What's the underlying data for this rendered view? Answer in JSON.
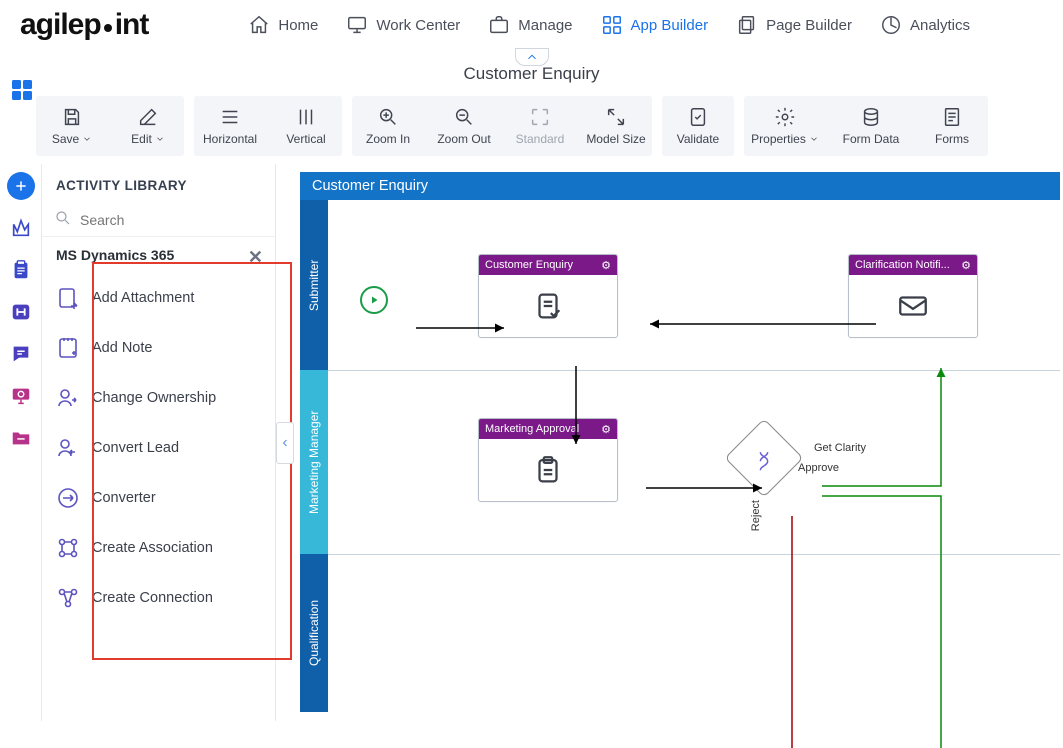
{
  "logo_text_1": "agilep",
  "logo_text_2": "int",
  "nav": {
    "home": "Home",
    "work_center": "Work Center",
    "manage": "Manage",
    "app_builder": "App Builder",
    "page_builder": "Page Builder",
    "analytics": "Analytics"
  },
  "page_title": "Customer Enquiry",
  "toolbar": {
    "save": "Save",
    "edit": "Edit",
    "horizontal": "Horizontal",
    "vertical": "Vertical",
    "zoom_in": "Zoom In",
    "zoom_out": "Zoom Out",
    "standard": "Standard",
    "model_size": "Model Size",
    "validate": "Validate",
    "properties": "Properties",
    "form_data": "Form Data",
    "forms": "Forms"
  },
  "panel": {
    "header": "ACTIVITY LIBRARY",
    "search_placeholder": "Search",
    "category": "MS Dynamics 365",
    "items": [
      "Add Attachment",
      "Add Note",
      "Change Ownership",
      "Convert Lead",
      "Converter",
      "Create Association",
      "Create Connection"
    ]
  },
  "canvas": {
    "title": "Customer Enquiry",
    "lanes": {
      "submitter": "Submitter",
      "marketing": "Marketing Manager",
      "qualification": "Qualification"
    },
    "nodes": {
      "customer_enquiry": "Customer Enquiry",
      "clarification": "Clarification Notifi...",
      "marketing_approval": "Marketing Approval"
    },
    "edges": {
      "get_clarity": "Get Clarity",
      "approve": "Approve",
      "reject": "Reject"
    }
  }
}
